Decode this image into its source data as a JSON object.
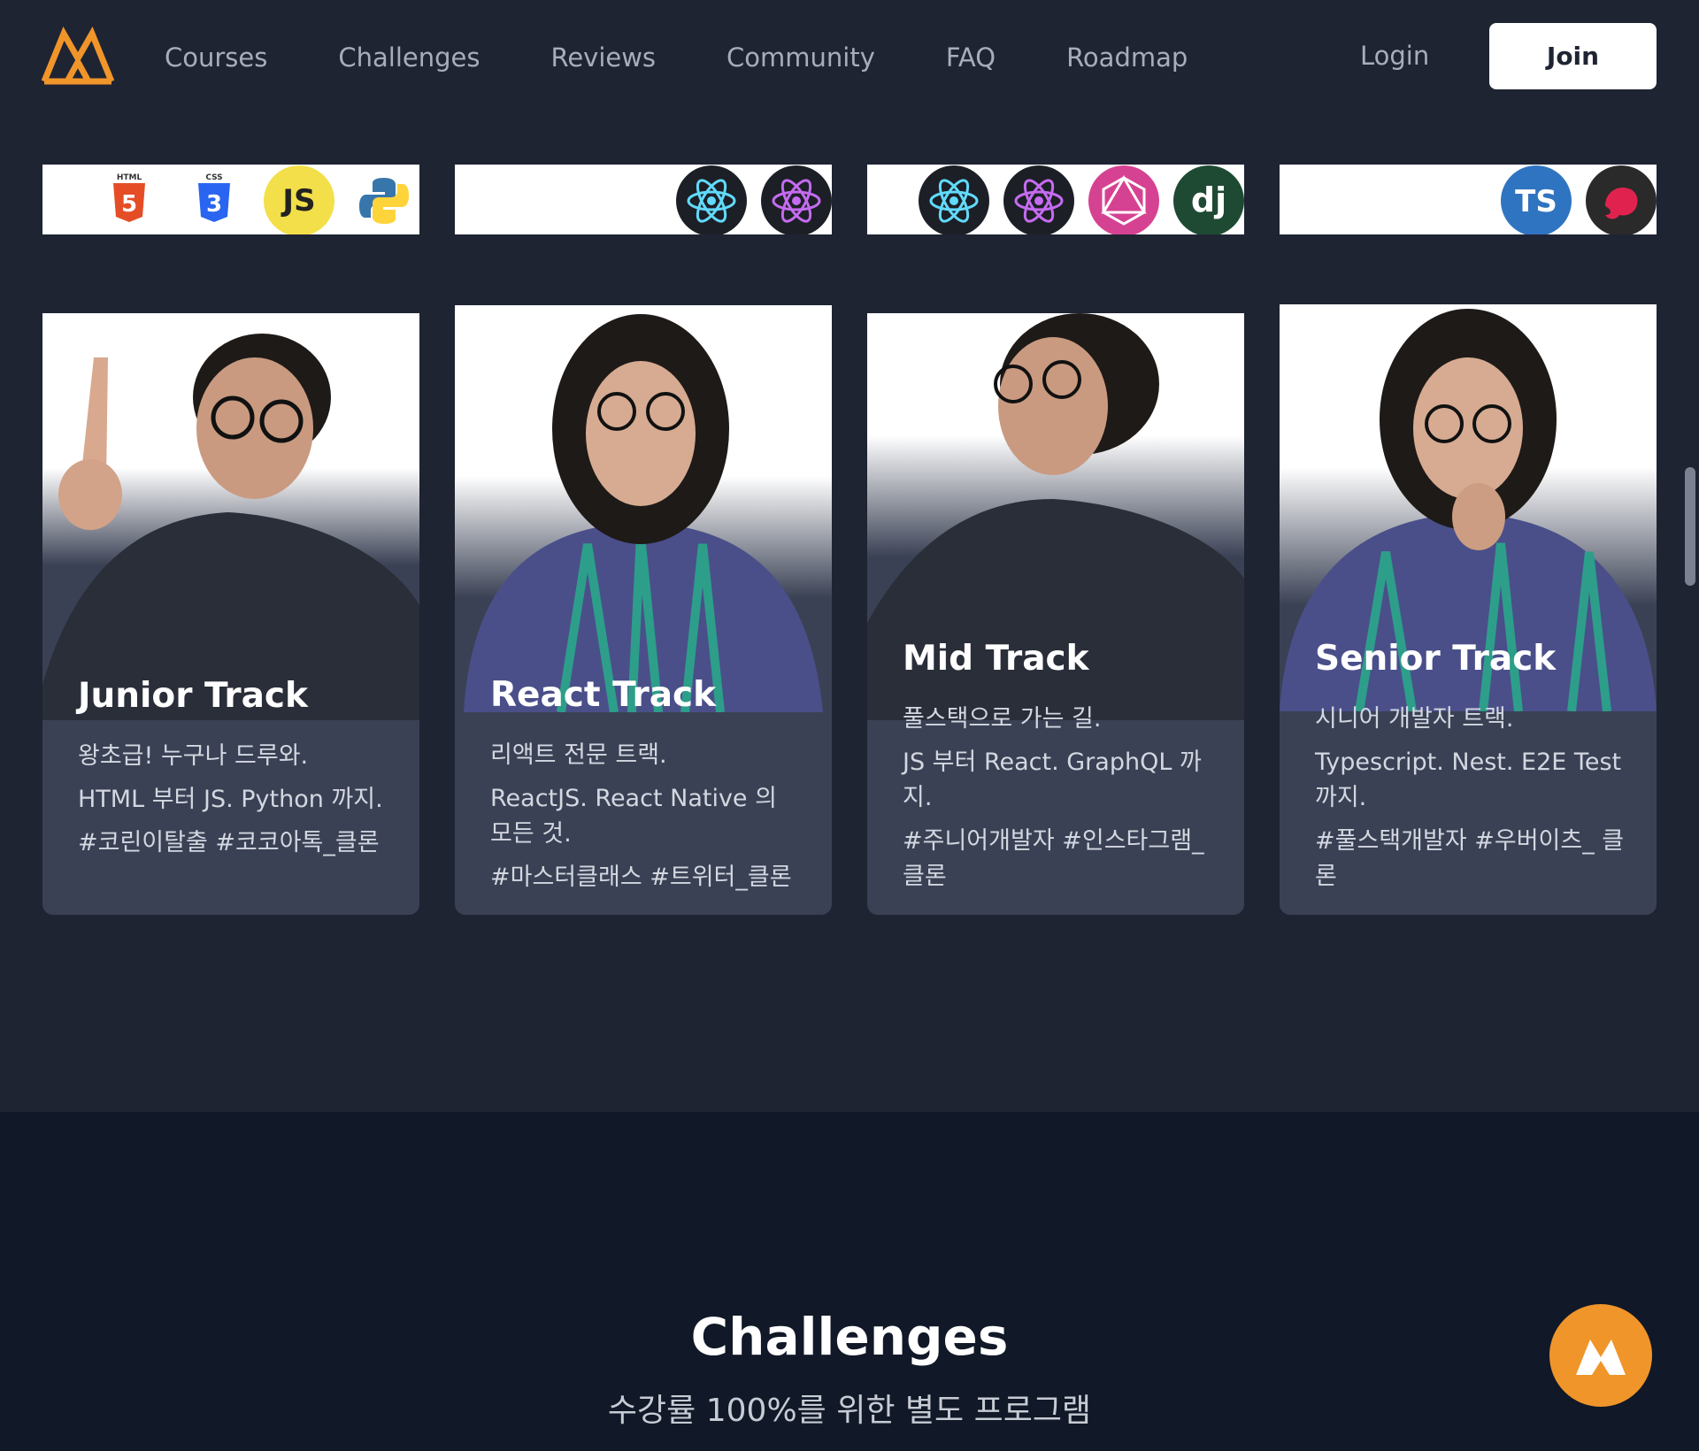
{
  "brand": {
    "logo_icon": "nomad-mountain-logo",
    "accent_color": "#f0952a"
  },
  "nav": {
    "items": [
      "Courses",
      "Challenges",
      "Reviews",
      "Community",
      "FAQ",
      "Roadmap"
    ],
    "login_label": "Login",
    "join_label": "Join"
  },
  "tracks": [
    {
      "title": "Junior Track",
      "lines": [
        "왕초급! 누구나 드루와.",
        "HTML 부터 JS. Python 까지.",
        "#코린이탈출 #코코아톡_클론"
      ],
      "icons": [
        "html5-icon",
        "css3-icon",
        "javascript-icon",
        "python-icon"
      ]
    },
    {
      "title": "React Track",
      "lines": [
        "리액트 전문 트랙.",
        "ReactJS. React Native 의 모든 것.",
        "#마스터클래스 #트위터_클론"
      ],
      "icons": [
        "react-icon",
        "react-native-icon"
      ]
    },
    {
      "title": "Mid Track",
      "lines": [
        "풀스택으로 가는 길.",
        "JS 부터 React. GraphQL 까지.",
        "#주니어개발자 #인스타그램_ 클론"
      ],
      "icons": [
        "react-icon",
        "react-native-icon",
        "graphql-icon",
        "django-icon"
      ]
    },
    {
      "title": "Senior Track",
      "lines": [
        "시니어 개발자 트랙.",
        "Typescript. Nest. E2E Test 까지.",
        "#풀스택개발자 #우버이츠_ 클론"
      ],
      "icons": [
        "typescript-icon",
        "nestjs-icon"
      ]
    }
  ],
  "icon_text": {
    "html": "HTML",
    "css": "CSS",
    "js": "JS",
    "ts": "TS",
    "dj": "dj"
  },
  "challenges": {
    "title": "Challenges",
    "subtitle": "수강률 100%를 위한 별도 프로그램"
  }
}
